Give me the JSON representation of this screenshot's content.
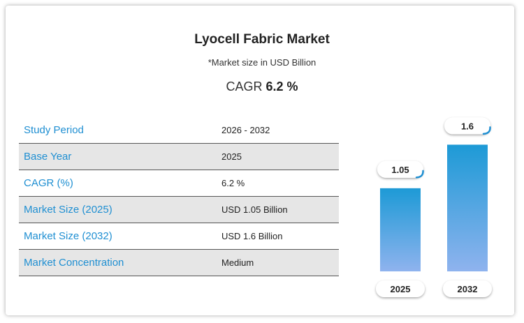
{
  "header": {
    "title": "Lyocell Fabric Market",
    "subtitle": "*Market size in USD Billion",
    "cagr_label": "CAGR",
    "cagr_value": "6.2 %"
  },
  "table": {
    "rows": [
      {
        "label": "Study Period",
        "value": "2026 - 2032"
      },
      {
        "label": "Base Year",
        "value": "2025"
      },
      {
        "label": "CAGR (%)",
        "value": "6.2 %"
      },
      {
        "label": "Market Size (2025)",
        "value": "USD 1.05 Billion"
      },
      {
        "label": "Market Size (2032)",
        "value": "USD 1.6 Billion"
      },
      {
        "label": "Market Concentration",
        "value": "Medium"
      }
    ]
  },
  "chart_data": {
    "type": "bar",
    "categories": [
      "2025",
      "2032"
    ],
    "values": [
      1.05,
      1.6
    ],
    "data_labels": [
      "1.05",
      "1.6"
    ],
    "title": "",
    "xlabel": "",
    "ylabel": "",
    "colors": {
      "bar_top": "#1d9ad6",
      "bar_bottom": "#8fb3ee",
      "label_accent": "#1f8fd2"
    }
  }
}
